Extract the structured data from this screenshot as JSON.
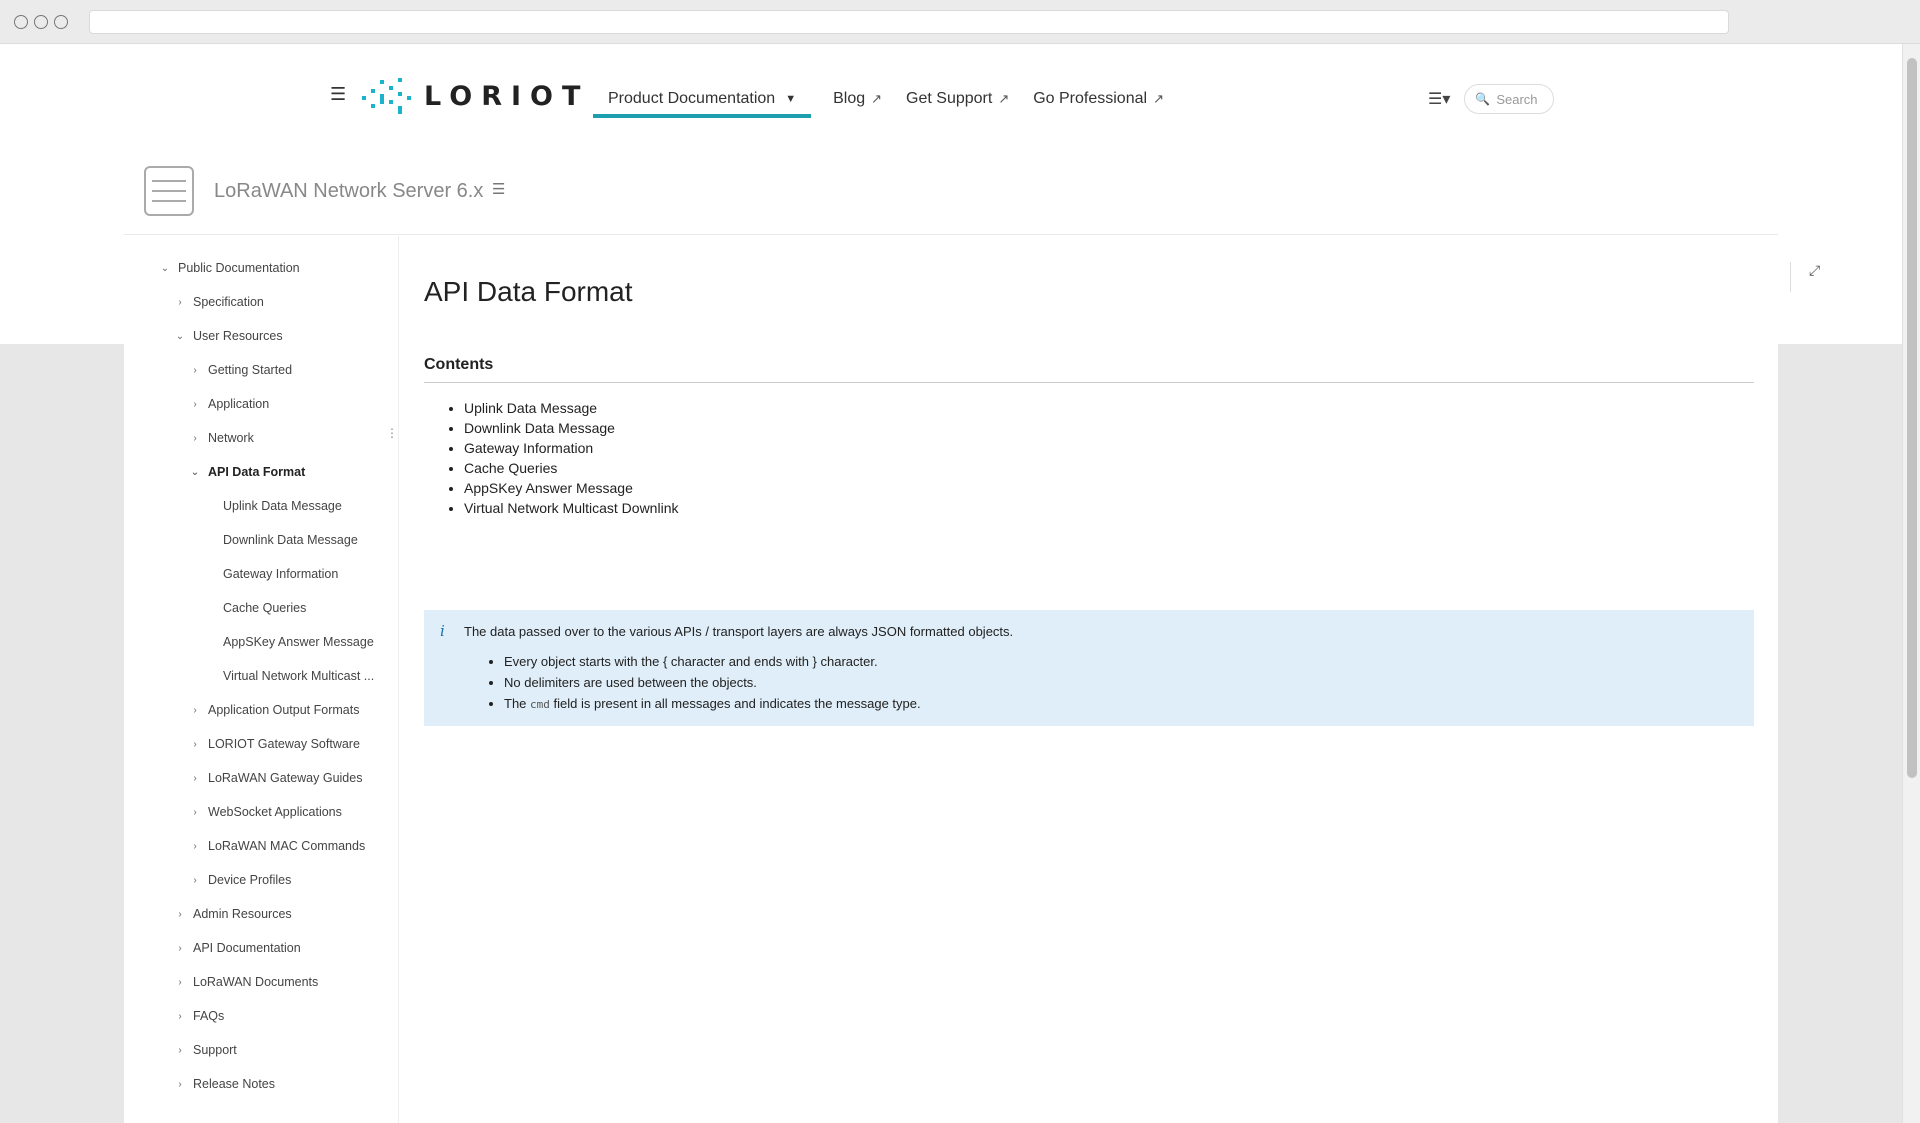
{
  "header": {
    "logo_text": "LORIOT",
    "nav": [
      {
        "label": "Product Documentation"
      },
      {
        "label": "Blog"
      },
      {
        "label": "Get Support"
      },
      {
        "label": "Go Professional"
      }
    ],
    "search_placeholder": "Search"
  },
  "space": {
    "title": "LoRaWAN Network Server 6.x"
  },
  "sidebar": {
    "items": [
      {
        "label": "Public Documentation",
        "level": 0,
        "state": "expanded"
      },
      {
        "label": "Specification",
        "level": 1,
        "state": "collapsed"
      },
      {
        "label": "User Resources",
        "level": 1,
        "state": "expanded"
      },
      {
        "label": "Getting Started",
        "level": 2,
        "state": "collapsed"
      },
      {
        "label": "Application",
        "level": 2,
        "state": "collapsed"
      },
      {
        "label": "Network",
        "level": 2,
        "state": "collapsed"
      },
      {
        "label": "API Data Format",
        "level": 2,
        "state": "expanded",
        "active": true
      },
      {
        "label": "Uplink Data Message",
        "level": 3,
        "state": "leaf"
      },
      {
        "label": "Downlink Data Message",
        "level": 3,
        "state": "leaf"
      },
      {
        "label": "Gateway Information",
        "level": 3,
        "state": "leaf"
      },
      {
        "label": "Cache Queries",
        "level": 3,
        "state": "leaf"
      },
      {
        "label": "AppSKey Answer Message",
        "level": 3,
        "state": "leaf"
      },
      {
        "label": "Virtual Network Multicast ...",
        "level": 3,
        "state": "leaf"
      },
      {
        "label": "Application Output Formats",
        "level": 2,
        "state": "collapsed"
      },
      {
        "label": "LORIOT Gateway Software",
        "level": 2,
        "state": "collapsed"
      },
      {
        "label": "LoRaWAN Gateway Guides",
        "level": 2,
        "state": "collapsed"
      },
      {
        "label": "WebSocket Applications",
        "level": 2,
        "state": "collapsed"
      },
      {
        "label": "LoRaWAN MAC Commands",
        "level": 2,
        "state": "collapsed"
      },
      {
        "label": "Device Profiles",
        "level": 2,
        "state": "collapsed"
      },
      {
        "label": "Admin Resources",
        "level": 1,
        "state": "collapsed"
      },
      {
        "label": "API Documentation",
        "level": 1,
        "state": "collapsed"
      },
      {
        "label": "LoRaWAN Documents",
        "level": 1,
        "state": "collapsed"
      },
      {
        "label": "FAQs",
        "level": 1,
        "state": "collapsed"
      },
      {
        "label": "Support",
        "level": 1,
        "state": "collapsed"
      },
      {
        "label": "Release Notes",
        "level": 1,
        "state": "collapsed"
      }
    ]
  },
  "page": {
    "title": "API Data Format",
    "contents_heading": "Contents",
    "toc": [
      "Uplink Data Message",
      "Downlink Data Message",
      "Gateway Information",
      "Cache Queries",
      "AppSKey Answer Message",
      "Virtual Network Multicast Downlink"
    ],
    "info": {
      "text": "The data passed over to the various APIs / transport layers are always JSON formatted objects.",
      "bullet1": "Every object starts with the { character and ends with } character.",
      "bullet2": "No delimiters are used between the objects.",
      "bullet3_pre": "The ",
      "bullet3_code": "cmd",
      "bullet3_post": " field is present in all messages and indicates the message type."
    }
  },
  "colors": {
    "accent": "#1e9fb0",
    "info_bg": "#dfeef8"
  }
}
